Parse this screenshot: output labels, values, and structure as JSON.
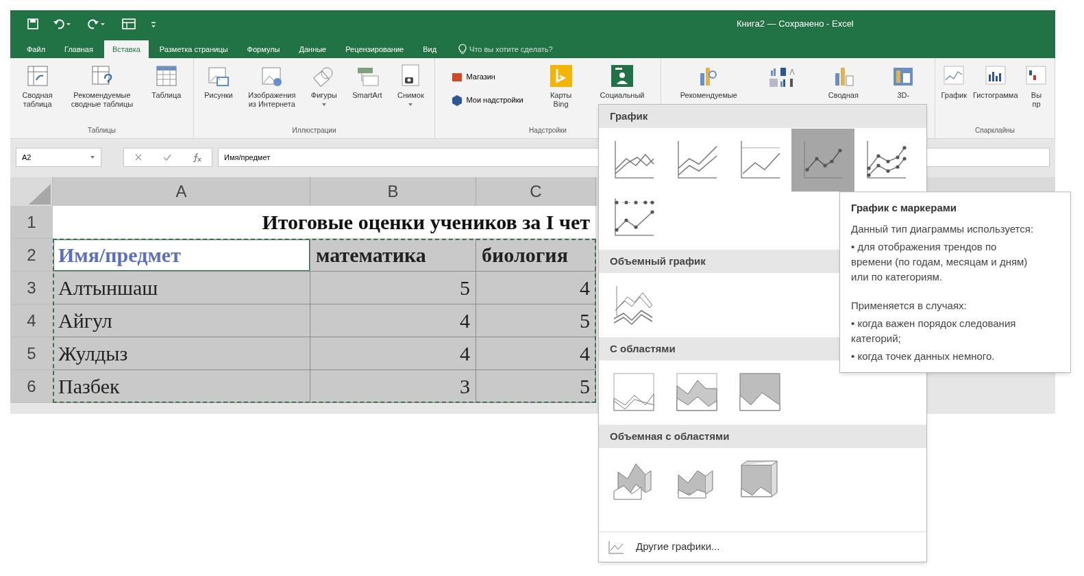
{
  "window": {
    "title": "Книга2 — Сохранено - Excel"
  },
  "ribbon_tabs": [
    {
      "label": "Файл",
      "selected": false
    },
    {
      "label": "Главная",
      "selected": false
    },
    {
      "label": "Вставка",
      "selected": true
    },
    {
      "label": "Разметка страницы",
      "selected": false
    },
    {
      "label": "Формулы",
      "selected": false
    },
    {
      "label": "Данные",
      "selected": false
    },
    {
      "label": "Рецензирование",
      "selected": false
    },
    {
      "label": "Вид",
      "selected": false
    }
  ],
  "tell_me": {
    "placeholder": "Что вы хотите сделать?"
  },
  "ribbon_groups": [
    {
      "label": "Таблицы",
      "buttons": [
        {
          "kind": "pivot",
          "lines": [
            "Сводная",
            "таблица"
          ]
        },
        {
          "kind": "recommended-pivot",
          "lines": [
            "Рекомендуемые",
            "сводные таблицы"
          ]
        },
        {
          "kind": "table",
          "lines": [
            "Таблица"
          ]
        }
      ]
    },
    {
      "label": "Иллюстрации",
      "buttons": [
        {
          "kind": "pictures",
          "lines": [
            "Рисунки"
          ]
        },
        {
          "kind": "online-pictures",
          "lines": [
            "Изображения",
            "из Интернета"
          ]
        },
        {
          "kind": "shapes",
          "lines": [
            "Фигуры"
          ],
          "dropdown": true
        },
        {
          "kind": "smartart",
          "lines": [
            "SmartArt"
          ]
        },
        {
          "kind": "screenshot",
          "lines": [
            "Снимок"
          ],
          "dropdown": true
        }
      ]
    },
    {
      "label": "Надстройки",
      "buttons": [
        {
          "kind": "store",
          "lines": [
            "Магазин"
          ]
        },
        {
          "kind": "my-addins",
          "lines": [
            "Мои надстройки"
          ]
        },
        {
          "kind": "bing",
          "lines": [
            "Карты",
            "Bing"
          ]
        },
        {
          "kind": "people",
          "lines": [
            "Социальный"
          ]
        }
      ]
    },
    {
      "buttons": [
        {
          "kind": "recommended-charts",
          "lines": [
            "Рекомендуемые"
          ]
        },
        {
          "kind": "chart-grid"
        },
        {
          "kind": "pivot-chart",
          "lines": [
            "Сводная"
          ]
        },
        {
          "kind": "map-3d",
          "lines": [
            "3D-"
          ]
        }
      ]
    },
    {
      "label": "Спарклайны",
      "buttons": [
        {
          "kind": "spark-line",
          "lines": [
            "График"
          ]
        },
        {
          "kind": "spark-column",
          "lines": [
            "Гистограмма"
          ]
        },
        {
          "kind": "spark-winloss",
          "lines": [
            "Вы",
            "пр"
          ]
        }
      ]
    }
  ],
  "name_box": {
    "value": "A2"
  },
  "formula_bar": {
    "value": "Имя/предмет"
  },
  "columns": [
    "A",
    "B",
    "C"
  ],
  "rows": [
    {
      "number": "1",
      "kind": "title",
      "cells": [
        {
          "text": "Итоговые оценки учеников за  I чет"
        }
      ]
    },
    {
      "number": "2",
      "kind": "header",
      "cells": [
        {
          "text": "Имя/предмет",
          "active": true
        },
        {
          "text": "математика",
          "active": false
        },
        {
          "text": "биология",
          "active": false
        }
      ]
    },
    {
      "number": "3",
      "kind": "data",
      "cells": [
        {
          "text": "Алтыншаш",
          "active": false
        },
        {
          "text": "5",
          "active": false
        },
        {
          "text": "4",
          "active": false
        }
      ]
    },
    {
      "number": "4",
      "kind": "data",
      "cells": [
        {
          "text": "Айгул",
          "active": false
        },
        {
          "text": "4",
          "active": false
        },
        {
          "text": "5",
          "active": false
        }
      ]
    },
    {
      "number": "5",
      "kind": "data",
      "cells": [
        {
          "text": "Жулдыз",
          "active": false
        },
        {
          "text": "4",
          "active": false
        },
        {
          "text": "4",
          "active": false
        }
      ]
    },
    {
      "number": "6",
      "kind": "data",
      "cells": [
        {
          "text": "Пазбек",
          "active": false
        },
        {
          "text": "3",
          "active": false
        },
        {
          "text": "5",
          "active": false
        }
      ]
    }
  ],
  "chart_menu": {
    "sections": [
      {
        "title": "График",
        "options": [
          {
            "kind": "line",
            "selected": false
          },
          {
            "kind": "stacked-line",
            "selected": false
          },
          {
            "kind": "line-100",
            "selected": false
          },
          {
            "kind": "line-markers",
            "selected": true
          },
          {
            "kind": "stacked-markers",
            "selected": false
          },
          {
            "kind": "markers-100",
            "selected": false
          }
        ]
      },
      {
        "title": "Объемный график",
        "options": [
          {
            "kind": "line-3d",
            "selected": false
          }
        ]
      },
      {
        "title": "С областями",
        "options": [
          {
            "kind": "area",
            "selected": false
          },
          {
            "kind": "stacked-area",
            "selected": false
          },
          {
            "kind": "area-100",
            "selected": false
          }
        ]
      },
      {
        "title": "Объемная с областями",
        "options": [
          {
            "kind": "area-3d",
            "selected": false
          },
          {
            "kind": "stacked-area-3d",
            "selected": false
          },
          {
            "kind": "area-100-3d",
            "selected": false
          }
        ]
      }
    ],
    "more": "Другие графики..."
  },
  "tooltip": {
    "title": "График с маркерами",
    "paragraphs": [
      "Данный тип диаграммы используется:",
      "• для отображения трендов по времени (по годам, месяцам и дням) или по категориям.",
      "Применяется в случаях:",
      "• когда важен порядок следования категорий;",
      "• когда точек данных немного."
    ]
  }
}
